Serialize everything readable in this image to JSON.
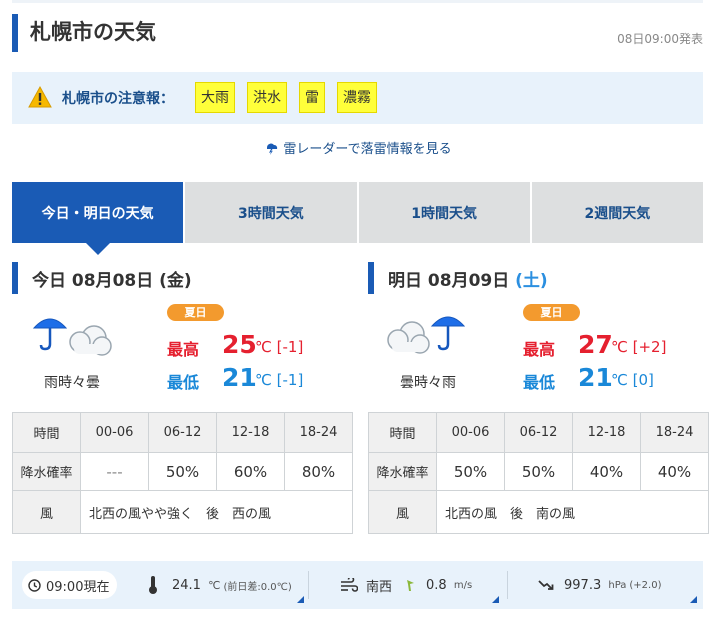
{
  "header": {
    "title": "札幌市の天気",
    "issued": "08日09:00発表"
  },
  "alert": {
    "label": "札幌市の注意報：",
    "items": [
      "大雨",
      "洪水",
      "雷",
      "濃霧"
    ],
    "icon": "warning-icon"
  },
  "radar_link": {
    "label": "雷レーダーで落雷情報を見る",
    "icon": "thunder-icon"
  },
  "tabs": [
    {
      "label": "今日・明日の天気",
      "active": true
    },
    {
      "label": "3時間天気",
      "active": false
    },
    {
      "label": "1時間天気",
      "active": false
    },
    {
      "label": "2週間天気",
      "active": false
    }
  ],
  "days": [
    {
      "prefix": "今日 08月08日 ",
      "dow": "(金)",
      "weather": "雨時々曇",
      "icon": "rain-sometimes-cloudy-icon",
      "badge": "夏日",
      "high_label": "最高",
      "high": "25",
      "high_unit": "℃",
      "high_diff": "[-1]",
      "low_label": "最低",
      "low": "21",
      "low_unit": "℃",
      "low_diff": "[-1]",
      "table": {
        "time_label": "時間",
        "periods": [
          "00-06",
          "06-12",
          "12-18",
          "18-24"
        ],
        "pop_label": "降水確率",
        "pop": [
          "---",
          "50%",
          "60%",
          "80%"
        ],
        "wind_label": "風",
        "wind": "北西の風やや強く　後　西の風"
      }
    },
    {
      "prefix": "明日 08月09日 ",
      "dow": "(土)",
      "weather": "曇時々雨",
      "icon": "cloudy-sometimes-rain-icon",
      "badge": "夏日",
      "high_label": "最高",
      "high": "27",
      "high_unit": "℃",
      "high_diff": "[+2]",
      "low_label": "最低",
      "low": "21",
      "low_unit": "℃",
      "low_diff": "[0]",
      "table": {
        "time_label": "時間",
        "periods": [
          "00-06",
          "06-12",
          "12-18",
          "18-24"
        ],
        "pop_label": "降水確率",
        "pop": [
          "50%",
          "50%",
          "40%",
          "40%"
        ],
        "wind_label": "風",
        "wind": "北西の風　後　南の風"
      }
    }
  ],
  "current": {
    "time": "09:00現在",
    "temp": "24.1",
    "temp_unit": "℃",
    "temp_diff": "(前日差:0.0℃)",
    "wind_dir": "南西",
    "wind_speed": "0.8",
    "wind_unit": "m/s",
    "pressure": "997.3",
    "pressure_unit": "hPa",
    "pressure_diff": "(+2.0)"
  },
  "colors": {
    "brand": "#1a5bb5",
    "high": "#e5202f",
    "low": "#1a88d8",
    "alert": "#ffff3a",
    "badge": "#f39a2e"
  }
}
